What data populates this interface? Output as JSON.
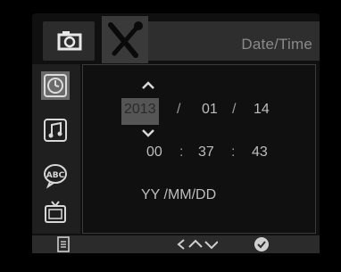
{
  "header": {
    "title": "Date/Time",
    "tabs": [
      {
        "name": "camera",
        "icon": "camera-icon"
      },
      {
        "name": "setup",
        "icon": "wrench-screwdriver-icon"
      }
    ]
  },
  "sidebar": {
    "items": [
      {
        "icon": "clock-icon"
      },
      {
        "icon": "music-note-icon"
      },
      {
        "icon": "abc-bubble-icon"
      },
      {
        "icon": "tv-icon"
      }
    ]
  },
  "datetime": {
    "year": "2013",
    "sep_date": "/",
    "month": "01",
    "day": "14",
    "hour": "00",
    "sep_time": ":",
    "minute": "37",
    "second": "43",
    "format": "YY /MM/DD"
  },
  "colors": {
    "background": "#000000",
    "panel": "#101010",
    "highlight": "#555555"
  }
}
